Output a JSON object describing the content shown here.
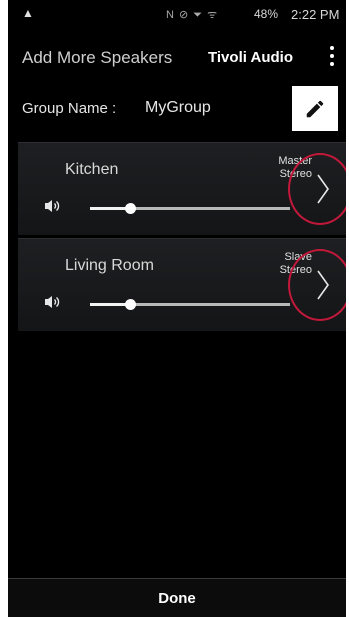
{
  "status_bar": {
    "left_icon": "warning-icon",
    "icons_text": "N ⊘ ⏷ ᯤ",
    "battery": "48%",
    "time": "2:22 PM"
  },
  "header": {
    "title": "Add More Speakers",
    "brand": "Tivoli Audio"
  },
  "group": {
    "label": "Group Name :",
    "value": "MyGroup"
  },
  "speakers": [
    {
      "name": "Kitchen",
      "role_line1": "Master",
      "role_line2": "Stereo",
      "volume": 0.2
    },
    {
      "name": "Living Room",
      "role_line1": "Slave",
      "role_line2": "Stereo",
      "volume": 0.2
    }
  ],
  "footer": {
    "done_label": "Done"
  },
  "colors": {
    "background": "#000000",
    "highlight_ring": "#c2193a",
    "edit_button": "#ffffff"
  }
}
